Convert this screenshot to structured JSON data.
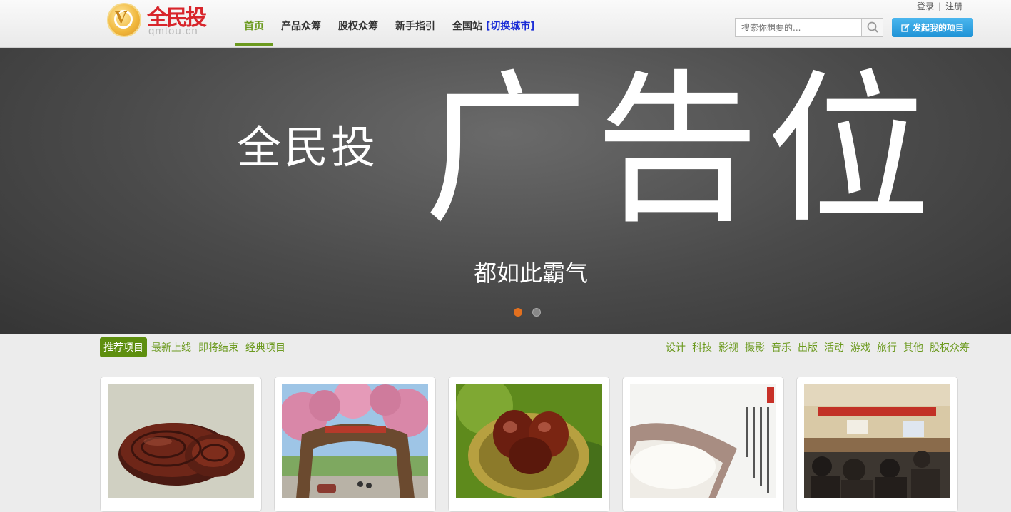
{
  "header": {
    "logo": {
      "cn": "全民投",
      "en": "qmtou.cn"
    },
    "nav": [
      {
        "label": "首页",
        "active": true
      },
      {
        "label": "产品众筹"
      },
      {
        "label": "股权众筹"
      },
      {
        "label": "新手指引"
      }
    ],
    "station": {
      "label": "全国站",
      "switch_label": "[切换城市]"
    },
    "search": {
      "placeholder": "搜索你想要的..."
    },
    "launch_button": "发起我的项目",
    "auth": {
      "login": "登录",
      "separator": "|",
      "register": "注册"
    }
  },
  "banner": {
    "brand": "全民投",
    "big_text": "广告位",
    "sub_text": "都如此霸气",
    "slides": 2,
    "active_slide": 1,
    "colors": {
      "active_dot": "#e2701f"
    }
  },
  "filters": {
    "tabs": [
      {
        "label": "推荐项目",
        "active": true
      },
      {
        "label": "最新上线"
      },
      {
        "label": "即将结束"
      },
      {
        "label": "经典项目"
      }
    ],
    "categories": [
      "设计",
      "科技",
      "影视",
      "摄影",
      "音乐",
      "出版",
      "活动",
      "游戏",
      "旅行",
      "其他",
      "股权众筹"
    ]
  },
  "projects": [
    {
      "image": "lingzhi-mushroom-photo"
    },
    {
      "image": "peach-blossom-gate-photo"
    },
    {
      "image": "chestnuts-photo"
    },
    {
      "image": "rice-grains-photo"
    },
    {
      "image": "conference-meeting-photo"
    }
  ],
  "colors": {
    "accent_green": "#6c9a1f",
    "brand_red": "#d8252b",
    "button_blue": "#1f93d6"
  }
}
